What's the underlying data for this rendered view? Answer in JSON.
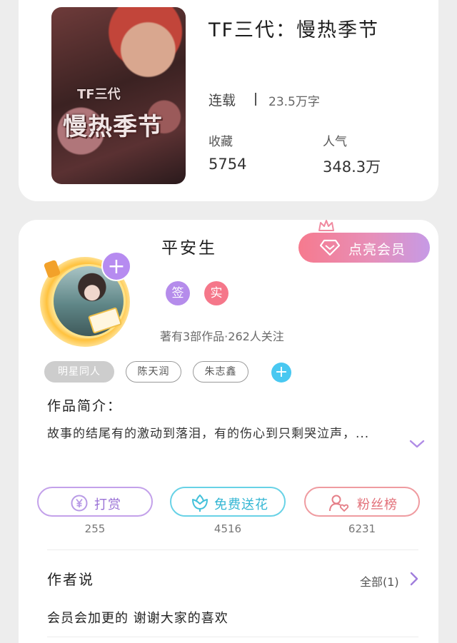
{
  "book": {
    "cover_title_text": "慢热季节",
    "cover_sub_text": "TF三代",
    "title": "TF三代：慢热季节",
    "status": "连载",
    "word_count": "23.5万字",
    "stats": [
      {
        "label": "收藏",
        "value": "5754"
      },
      {
        "label": "人气",
        "value": "348.3万"
      }
    ]
  },
  "author": {
    "name": "平安生",
    "follow_symbol": "+",
    "member_button": "点亮会员",
    "badges": [
      "签",
      "实"
    ],
    "meta": "著有3部作品·262人关注",
    "tags": [
      "明星同人",
      "陈天润",
      "朱志鑫"
    ],
    "add_tag_symbol": "+",
    "intro_title": "作品简介：",
    "intro_text": "故事的结尾有的激动到落泪，有的伤心到只剩哭泣声，...",
    "actions": [
      {
        "label": "打赏",
        "count": "255"
      },
      {
        "label": "免费送花",
        "count": "4516"
      },
      {
        "label": "粉丝榜",
        "count": "6231"
      }
    ],
    "say_title": "作者说",
    "say_all": "全部(1)",
    "say_text": "会员会加更的 谢谢大家的喜欢"
  },
  "colors": {
    "purple": "#b58ceb",
    "pink": "#f5778a",
    "cyan": "#49c8f1",
    "member_gradient_start": "#f67a8e",
    "member_gradient_end": "#c69ae6"
  },
  "icons": [
    "crown-icon",
    "diamond-icon",
    "yen-icon",
    "flower-icon",
    "fan-user-icon",
    "chevron-down-icon",
    "chevron-right-icon",
    "plus-icon"
  ]
}
